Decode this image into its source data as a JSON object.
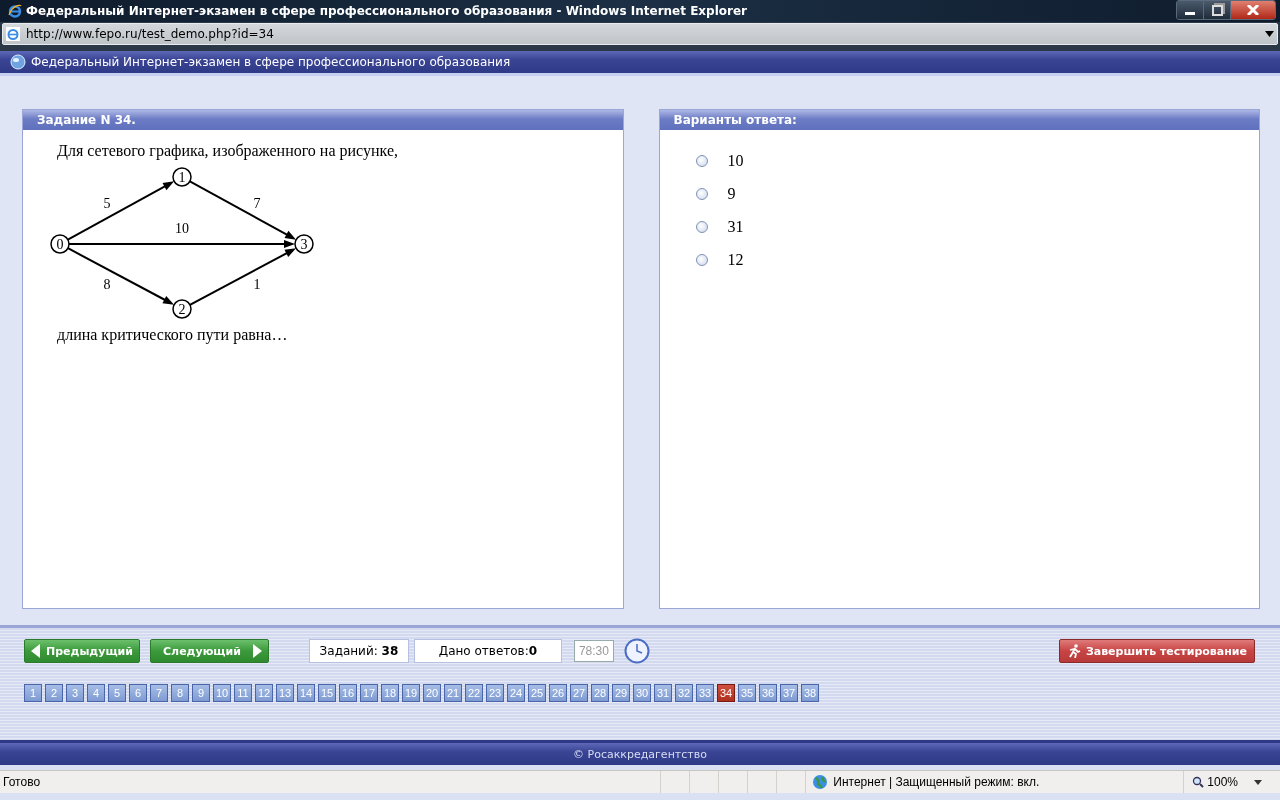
{
  "window": {
    "title": "Федеральный Интернет-экзамен в сфере профессионального образования - Windows Internet Explorer"
  },
  "address_bar": {
    "url": "http://www.fepo.ru/test_demo.php?id=34"
  },
  "page_header": {
    "title": "Федеральный Интернет-экзамен в сфере профессионального образования"
  },
  "task": {
    "title": "Задание N 34.",
    "prompt": "Для сетевого графика, изображенного на рисунке,",
    "graph": {
      "nodes": [
        "0",
        "1",
        "2",
        "3"
      ],
      "edges": [
        {
          "label": "5"
        },
        {
          "label": "7"
        },
        {
          "label": "10"
        },
        {
          "label": "8"
        },
        {
          "label": "1"
        }
      ]
    },
    "question": "длина критического пути равна…"
  },
  "answers": {
    "title": "Варианты ответа:",
    "options": [
      {
        "label": "10",
        "selected": false
      },
      {
        "label": "9",
        "selected": false
      },
      {
        "label": "31",
        "selected": false
      },
      {
        "label": "12",
        "selected": false
      }
    ]
  },
  "nav": {
    "prev": "Предыдущий",
    "next": "Следующий",
    "tasks": "Заданий: **38**",
    "answered": "Дано ответов:**0**",
    "timer": "78:30",
    "finish": "Завершить тестирование",
    "pages": [
      {
        "label": "1",
        "selected": false
      },
      {
        "label": "2",
        "selected": false
      },
      {
        "label": "3",
        "selected": false
      },
      {
        "label": "4",
        "selected": false
      },
      {
        "label": "5",
        "selected": false
      },
      {
        "label": "6",
        "selected": false
      },
      {
        "label": "7",
        "selected": false
      },
      {
        "label": "8",
        "selected": false
      },
      {
        "label": "9",
        "selected": false
      },
      {
        "label": "10",
        "selected": false
      },
      {
        "label": "11",
        "selected": false
      },
      {
        "label": "12",
        "selected": false
      },
      {
        "label": "13",
        "selected": false
      },
      {
        "label": "14",
        "selected": false
      },
      {
        "label": "15",
        "selected": false
      },
      {
        "label": "16",
        "selected": false
      },
      {
        "label": "17",
        "selected": false
      },
      {
        "label": "18",
        "selected": false
      },
      {
        "label": "19",
        "selected": false
      },
      {
        "label": "20",
        "selected": false
      },
      {
        "label": "21",
        "selected": false
      },
      {
        "label": "22",
        "selected": false
      },
      {
        "label": "23",
        "selected": false
      },
      {
        "label": "24",
        "selected": false
      },
      {
        "label": "25",
        "selected": false
      },
      {
        "label": "26",
        "selected": false
      },
      {
        "label": "27",
        "selected": false
      },
      {
        "label": "28",
        "selected": false
      },
      {
        "label": "29",
        "selected": false
      },
      {
        "label": "30",
        "selected": false
      },
      {
        "label": "31",
        "selected": false
      },
      {
        "label": "32",
        "selected": false
      },
      {
        "label": "33",
        "selected": false
      },
      {
        "label": "34",
        "selected": true
      },
      {
        "label": "35",
        "selected": false
      },
      {
        "label": "36",
        "selected": false
      },
      {
        "label": "37",
        "selected": false
      },
      {
        "label": "38",
        "selected": false
      }
    ]
  },
  "footer": {
    "copyright": "© Росаккредагентство"
  },
  "status_bar": {
    "status": "Готово",
    "zone": "Интернет | Защищенный режим: вкл.",
    "zoom": "100%"
  }
}
